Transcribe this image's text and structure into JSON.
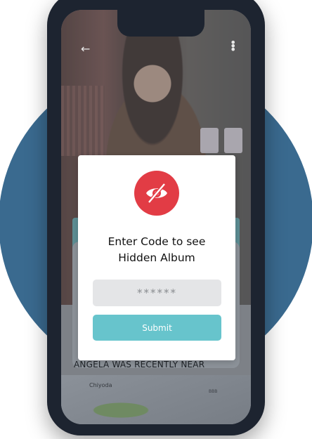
{
  "modal": {
    "title_line1": "Enter Code to see",
    "title_line2": "Hidden Album",
    "code_placeholder": "******",
    "submit_label": "Submit",
    "icon": "eye-slash-icon",
    "accent_color": "#e23c45",
    "button_color": "#67c4cc"
  },
  "screen": {
    "recent_text": "ANGELA WAS RECENTLY NEAR",
    "map_label": "Chiyoda",
    "map_label_small": "BBB"
  },
  "colors": {
    "background_circle": "#3a6a8f",
    "phone_frame": "#1d2430"
  }
}
